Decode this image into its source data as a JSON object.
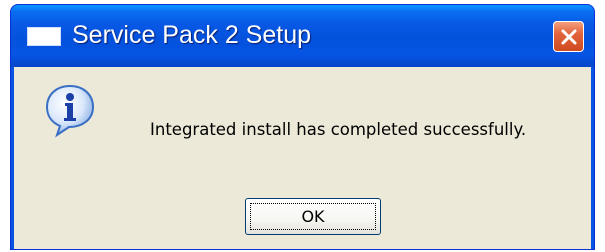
{
  "window": {
    "title": "Service Pack 2 Setup",
    "accent": "#0a54e2",
    "close_color": "#e2643c"
  },
  "dialog": {
    "icon": "information-icon",
    "message": "Integrated install has completed successfully.",
    "ok_label": "OK"
  },
  "colors": {
    "client_background": "#ece9d8"
  }
}
